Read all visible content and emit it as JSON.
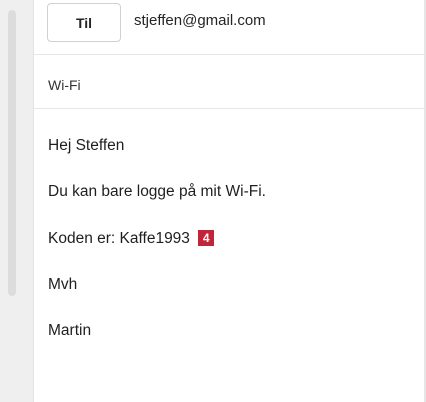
{
  "compose": {
    "to_label": "Til",
    "recipient": "stjeffen@gmail.com",
    "subject": "Wi-Fi"
  },
  "body": {
    "greeting": "Hej Steffen",
    "message": "Du kan bare logge på mit Wi-Fi.",
    "code_prefix": "Koden er:",
    "code_value": "Kaffe1993",
    "marker_number": "4",
    "closing": "Mvh",
    "signature": "Martin"
  },
  "colors": {
    "marker_badge": "#c0263a"
  }
}
